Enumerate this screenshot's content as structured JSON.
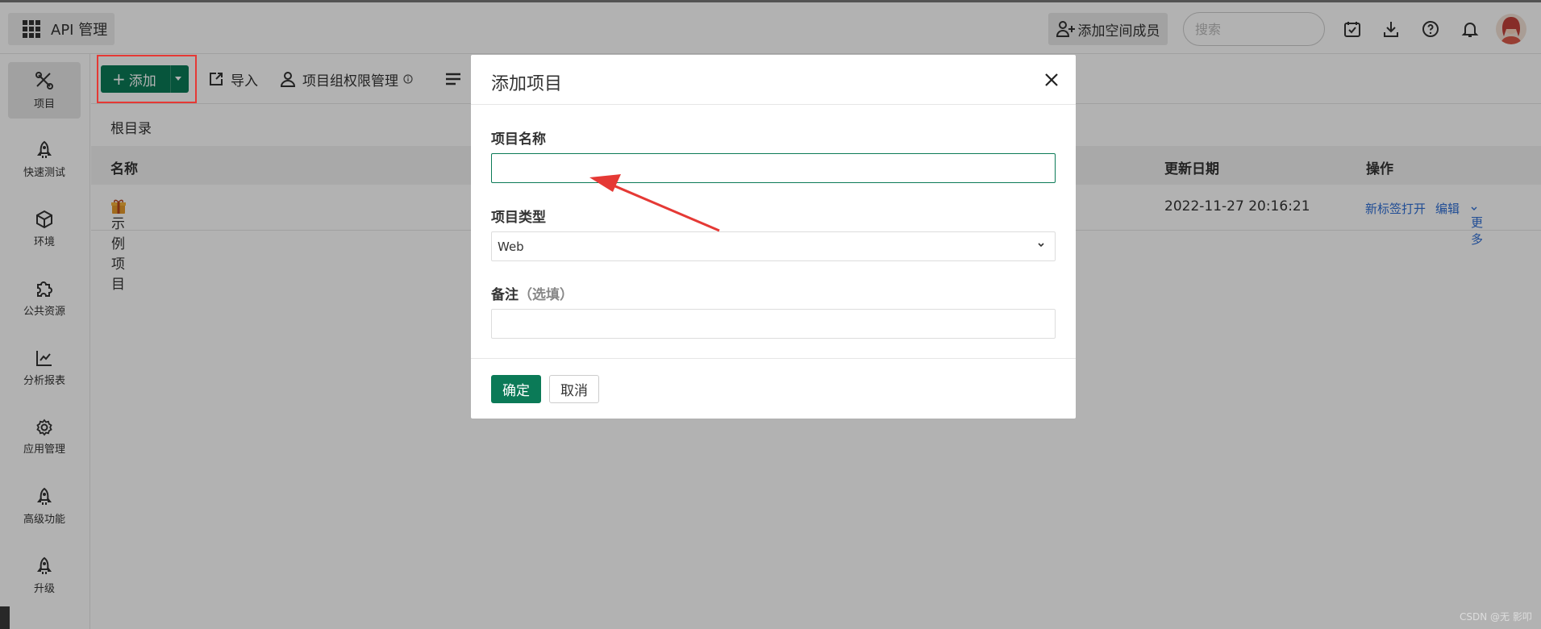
{
  "header": {
    "app_title": "API 管理",
    "invite_label": "添加空间成员",
    "search_placeholder": "搜索",
    "icons": [
      "checklist-icon",
      "download-icon",
      "help-icon",
      "bell-icon"
    ]
  },
  "sidebar": {
    "items": [
      {
        "label": "项目",
        "icon": "project-icon",
        "active": true
      },
      {
        "label": "快速测试",
        "icon": "rocket-icon"
      },
      {
        "label": "环境",
        "icon": "environment-icon"
      },
      {
        "label": "公共资源",
        "icon": "puzzle-icon"
      },
      {
        "label": "分析报表",
        "icon": "chart-icon"
      },
      {
        "label": "应用管理",
        "icon": "settings-icon"
      },
      {
        "label": "高级功能",
        "icon": "rocket-icon"
      },
      {
        "label": "升级",
        "icon": "rocket-icon"
      }
    ]
  },
  "toolbar": {
    "add_label": "添加",
    "import_label": "导入",
    "permission_label": "项目组权限管理"
  },
  "list": {
    "breadcrumb": "根目录",
    "columns": {
      "name": "名称",
      "updated": "更新日期",
      "actions": "操作"
    },
    "rows": [
      {
        "name": "示例项目",
        "updated": "2022-11-27 20:16:21",
        "open_tab": "新标签打开",
        "edit": "编辑",
        "more": "更多"
      }
    ]
  },
  "modal": {
    "title": "添加项目",
    "name_label": "项目名称",
    "name_value": "",
    "type_label": "项目类型",
    "type_value": "Web",
    "note_label": "备注",
    "note_optional": "（选填）",
    "note_value": "",
    "ok_label": "确定",
    "cancel_label": "取消"
  },
  "watermark": "CSDN @无 影叩",
  "colors": {
    "primary": "#0b7a57",
    "link": "#2f6fd6",
    "annotation": "#e53935"
  }
}
